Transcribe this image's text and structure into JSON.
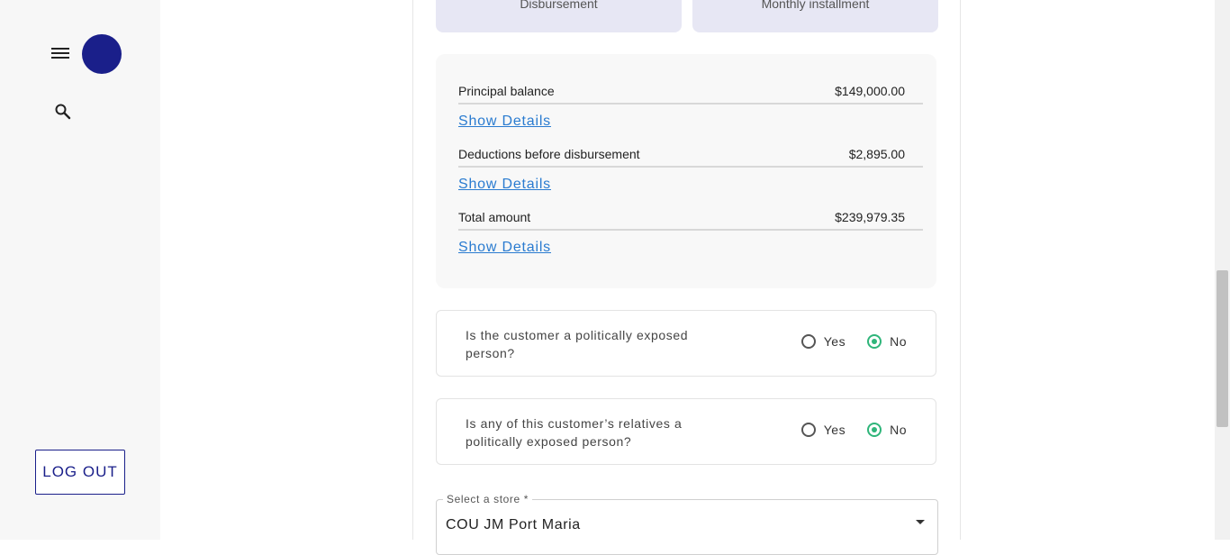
{
  "sidebar": {
    "menu_icon": "hamburger-menu-icon",
    "search_icon": "search-icon",
    "logout_label": "LOG OUT",
    "avatar_color": "#1a1f8a"
  },
  "top_cards": {
    "left_label": "Disbursement",
    "right_label": "Monthly installment"
  },
  "summary": {
    "rows": [
      {
        "label": "Principal balance",
        "value": "$149,000.00"
      },
      {
        "label": "Deductions before disbursement",
        "value": "$2,895.00"
      },
      {
        "label": "Total amount",
        "value": "$239,979.35"
      }
    ],
    "show_details_label": "Show Details"
  },
  "pep": {
    "questions": [
      {
        "text": "Is the customer a politically exposed person?",
        "selected": "No"
      },
      {
        "text": "Is any of this customer’s relatives a politically exposed person?",
        "selected": "No"
      }
    ],
    "yes_label": "Yes",
    "no_label": "No",
    "accent": "#2fb57a"
  },
  "store": {
    "label": "Select a store *",
    "value": "COU JM Port Maria"
  }
}
